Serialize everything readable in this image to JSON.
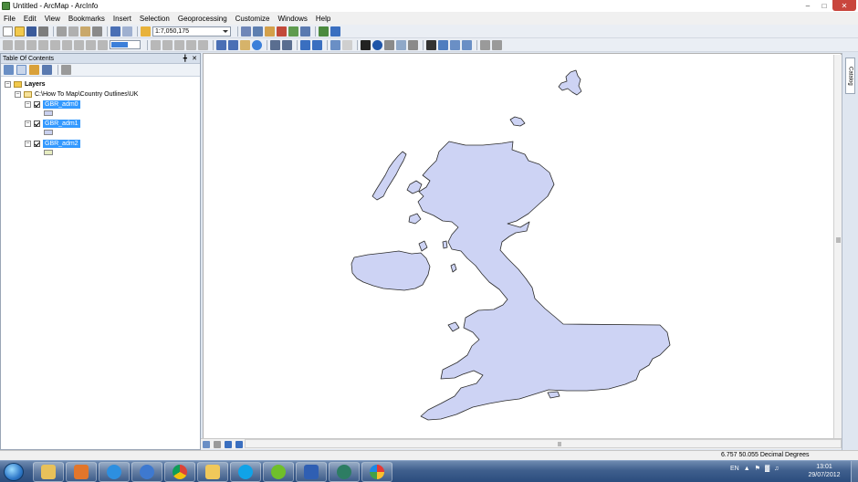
{
  "window": {
    "title": "Untitled - ArcMap - ArcInfo"
  },
  "menu": [
    "File",
    "Edit",
    "View",
    "Bookmarks",
    "Insert",
    "Selection",
    "Geoprocessing",
    "Customize",
    "Windows",
    "Help"
  ],
  "toolbar": {
    "scale": "1:7,050,175"
  },
  "toc": {
    "title": "Table Of Contents",
    "root": "Layers",
    "folder": "C:\\How To Map\\Country Outlines\\UK",
    "layers": [
      {
        "name": "GBR_adm0",
        "fill": "#c9d0ee"
      },
      {
        "name": "GBR_adm1",
        "fill": "#c9d0ee"
      },
      {
        "name": "GBR_adm2",
        "fill": "#e6ecc0"
      }
    ]
  },
  "map": {
    "land_fill": "#cdd3f4",
    "outline": "#2b2b2b"
  },
  "sidepanel": {
    "catalog_label": "Catalog"
  },
  "status": {
    "coords": "6.757  50.055 Decimal Degrees"
  },
  "taskbar": {
    "time": "13:01",
    "date": "29/07/2012",
    "tray_label": "EN"
  }
}
